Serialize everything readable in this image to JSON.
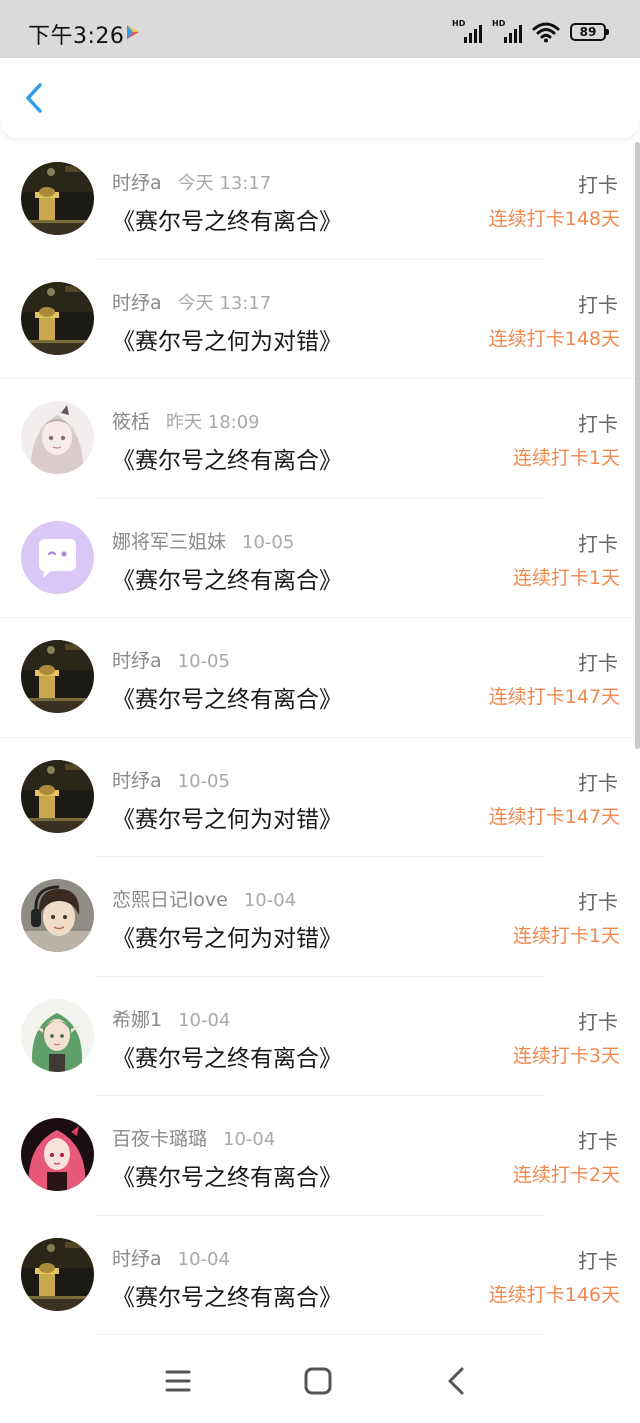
{
  "status_bar": {
    "time": "下午3:26",
    "sim1_label": "HD",
    "sim2_label": "HD",
    "battery": "89"
  },
  "colors": {
    "accent_blue": "#2f9bea",
    "streak_orange": "#f0894f"
  },
  "entries": [
    {
      "user": "时纾a",
      "time": "今天 13:17",
      "title": "《赛尔号之终有离合》",
      "action": "打卡",
      "streak": "连续打卡148天",
      "avatar": "dark-room"
    },
    {
      "user": "时纾a",
      "time": "今天 13:17",
      "title": "《赛尔号之何为对错》",
      "action": "打卡",
      "streak": "连续打卡148天",
      "avatar": "dark-room"
    },
    {
      "user": "筱栝",
      "time": "昨天 18:09",
      "title": "《赛尔号之终有离合》",
      "action": "打卡",
      "streak": "连续打卡1天",
      "avatar": "anime-girl-white"
    },
    {
      "user": "娜将军三姐妹",
      "time": "10-05",
      "title": "《赛尔号之终有离合》",
      "action": "打卡",
      "streak": "连续打卡1天",
      "avatar": "chat-bubble-default"
    },
    {
      "user": "时纾a",
      "time": "10-05",
      "title": "《赛尔号之终有离合》",
      "action": "打卡",
      "streak": "连续打卡147天",
      "avatar": "dark-room"
    },
    {
      "user": "时纾a",
      "time": "10-05",
      "title": "《赛尔号之何为对错》",
      "action": "打卡",
      "streak": "连续打卡147天",
      "avatar": "dark-room"
    },
    {
      "user": "恋熙日记love",
      "time": "10-04",
      "title": "《赛尔号之何为对错》",
      "action": "打卡",
      "streak": "连续打卡1天",
      "avatar": "anime-boy-headphones"
    },
    {
      "user": "希娜1",
      "time": "10-04",
      "title": "《赛尔号之终有离合》",
      "action": "打卡",
      "streak": "连续打卡3天",
      "avatar": "anime-elf-green"
    },
    {
      "user": "百夜卡璐璐",
      "time": "10-04",
      "title": "《赛尔号之终有离合》",
      "action": "打卡",
      "streak": "连续打卡2天",
      "avatar": "anime-girl-pink"
    },
    {
      "user": "时纾a",
      "time": "10-04",
      "title": "《赛尔号之终有离合》",
      "action": "打卡",
      "streak": "连续打卡146天",
      "avatar": "dark-room"
    }
  ],
  "icons": {
    "back": "chevron-left-icon",
    "nav_menu": "menu-icon",
    "nav_home": "home-square-icon",
    "nav_back": "back-triangle-icon"
  }
}
